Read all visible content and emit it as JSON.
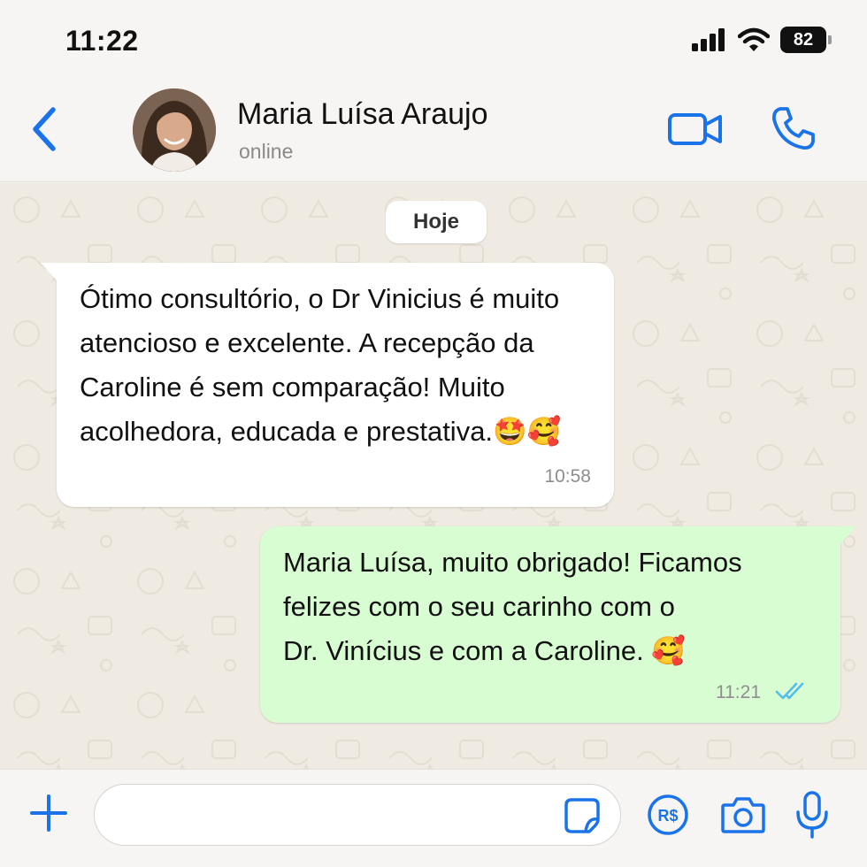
{
  "status_bar": {
    "time": "11:22",
    "battery": "82",
    "icons": [
      "signal-icon",
      "wifi-icon",
      "battery-icon"
    ]
  },
  "header": {
    "contact_name": "Maria Luísa Araujo",
    "contact_status": "online",
    "icons": [
      "back-chevron-icon",
      "avatar",
      "video-call-icon",
      "phone-icon"
    ]
  },
  "chat": {
    "date_chip": "Hoje",
    "messages": [
      {
        "direction": "incoming",
        "text": "Ótimo consultório, o Dr Vinicius é muito\natencioso e excelente. A recepção da\nCaroline é sem comparação! Muito\nacolhedora, educada e prestativa.🤩🥰",
        "time": "10:58"
      },
      {
        "direction": "outgoing",
        "text": "Maria Luísa, muito obrigado! Ficamos\nfelizes com o seu carinho com o\nDr. Vinícius e com a Caroline. 🥰",
        "time": "11:21",
        "status": "read"
      }
    ]
  },
  "input_bar": {
    "value": "",
    "placeholder": "",
    "icons": [
      "plus-icon",
      "sticker-icon",
      "pix-payment-icon",
      "camera-icon",
      "microphone-icon"
    ],
    "pay_label": "R$"
  },
  "colors": {
    "accent": "#1a73e8",
    "incoming_bubble": "#ffffff",
    "outgoing_bubble": "#d9fdd3",
    "chat_background": "#efeae2",
    "read_tick": "#53bdeb"
  }
}
